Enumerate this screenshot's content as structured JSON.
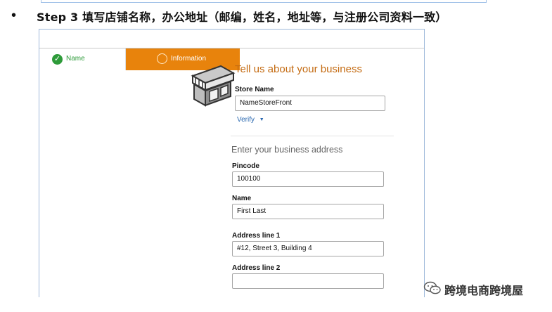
{
  "instruction": {
    "bullet": "•",
    "heading": "Step 3 填写店铺名称，办公地址（邮编，姓名，地址等，与注册公司资料一致）"
  },
  "stepper": {
    "step1_label": "Name",
    "step2_label": "Information",
    "active_color": "#e8830c",
    "done_color": "#2e9b3a"
  },
  "form": {
    "title": "Tell us about your business",
    "store_name_label": "Store Name",
    "store_name_value": "NameStoreFront",
    "verify_label": "Verify",
    "address_heading": "Enter your business address",
    "pincode_label": "Pincode",
    "pincode_value": "100100",
    "name_label": "Name",
    "name_value": "First Last",
    "address1_label": "Address line 1",
    "address1_value": "#12, Street 3, Building 4",
    "address2_label": "Address line 2",
    "address2_value": ""
  },
  "watermark": {
    "icon": "wechat-icon",
    "text": "跨境电商跨境屋"
  }
}
